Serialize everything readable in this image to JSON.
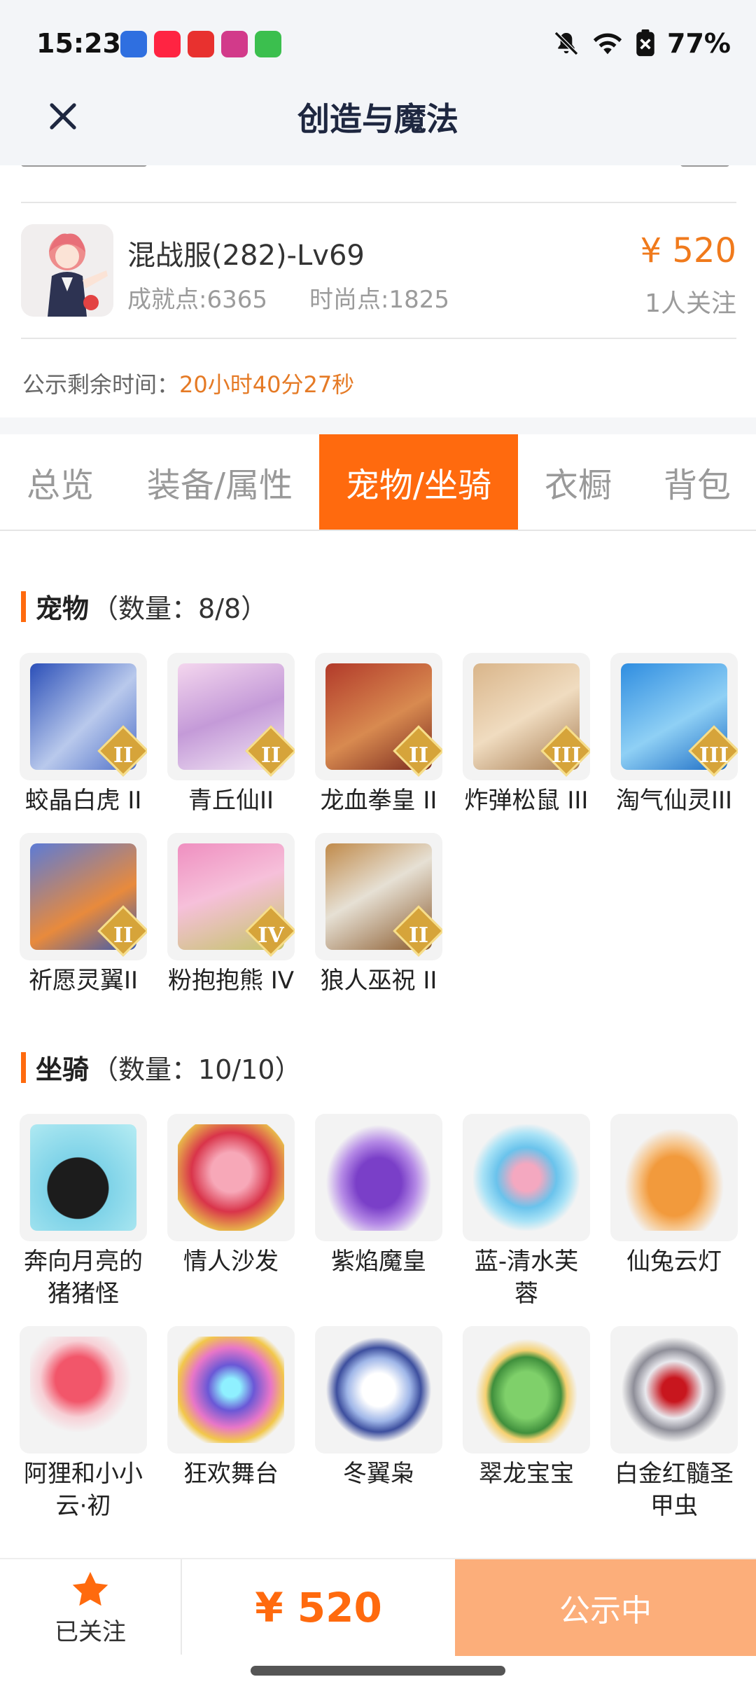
{
  "status_bar": {
    "time": "15:23",
    "battery": "77%"
  },
  "header": {
    "title": "创造与魔法"
  },
  "product": {
    "server": "混战服(282)-Lv69",
    "achievement": "成就点:6365",
    "fashion": "时尚点:1825",
    "price": "¥ 520",
    "followers": "1人关注",
    "remaining_label": "公示剩余时间：",
    "remaining_value": "20小时40分27秒"
  },
  "tabs": [
    {
      "label": "总览"
    },
    {
      "label": "装备/属性"
    },
    {
      "label": "宠物/坐骑"
    },
    {
      "label": "衣橱"
    },
    {
      "label": "背包"
    }
  ],
  "pets": {
    "title": "宠物",
    "count": "（数量：8/8）",
    "items": [
      {
        "name": "蛟晶白虎 II",
        "badge": "II"
      },
      {
        "name": "青丘仙II",
        "badge": "II"
      },
      {
        "name": "龙血拳皇 II",
        "badge": "II"
      },
      {
        "name": "炸弹松鼠 III",
        "badge": "III"
      },
      {
        "name": "淘气仙灵III",
        "badge": "III"
      },
      {
        "name": "祈愿灵翼II",
        "badge": "II"
      },
      {
        "name": "粉抱抱熊 IV",
        "badge": "IV"
      },
      {
        "name": "狼人巫祝 II",
        "badge": "II"
      }
    ]
  },
  "mounts": {
    "title": "坐骑",
    "count": "（数量：10/10）",
    "items": [
      {
        "name_line1": "奔向月亮的",
        "name_line2": "猪猪怪"
      },
      {
        "name_line1": "情人沙发",
        "name_line2": ""
      },
      {
        "name_line1": "紫焰魔皇",
        "name_line2": ""
      },
      {
        "name_line1": "蓝-清水芙",
        "name_line2": "蓉"
      },
      {
        "name_line1": "仙兔云灯",
        "name_line2": ""
      },
      {
        "name_line1": "阿狸和小小",
        "name_line2": "云·初"
      },
      {
        "name_line1": "狂欢舞台",
        "name_line2": ""
      },
      {
        "name_line1": "冬翼枭",
        "name_line2": ""
      },
      {
        "name_line1": "翠龙宝宝",
        "name_line2": ""
      },
      {
        "name_line1": "白金红髓圣",
        "name_line2": "甲虫"
      }
    ]
  },
  "bottom": {
    "follow_label": "已关注",
    "price": "¥ 520",
    "status_label": "公示中"
  },
  "colors": {
    "accent": "#ff6a0e",
    "price": "#f07a1c",
    "status_button": "#fcae7a"
  }
}
